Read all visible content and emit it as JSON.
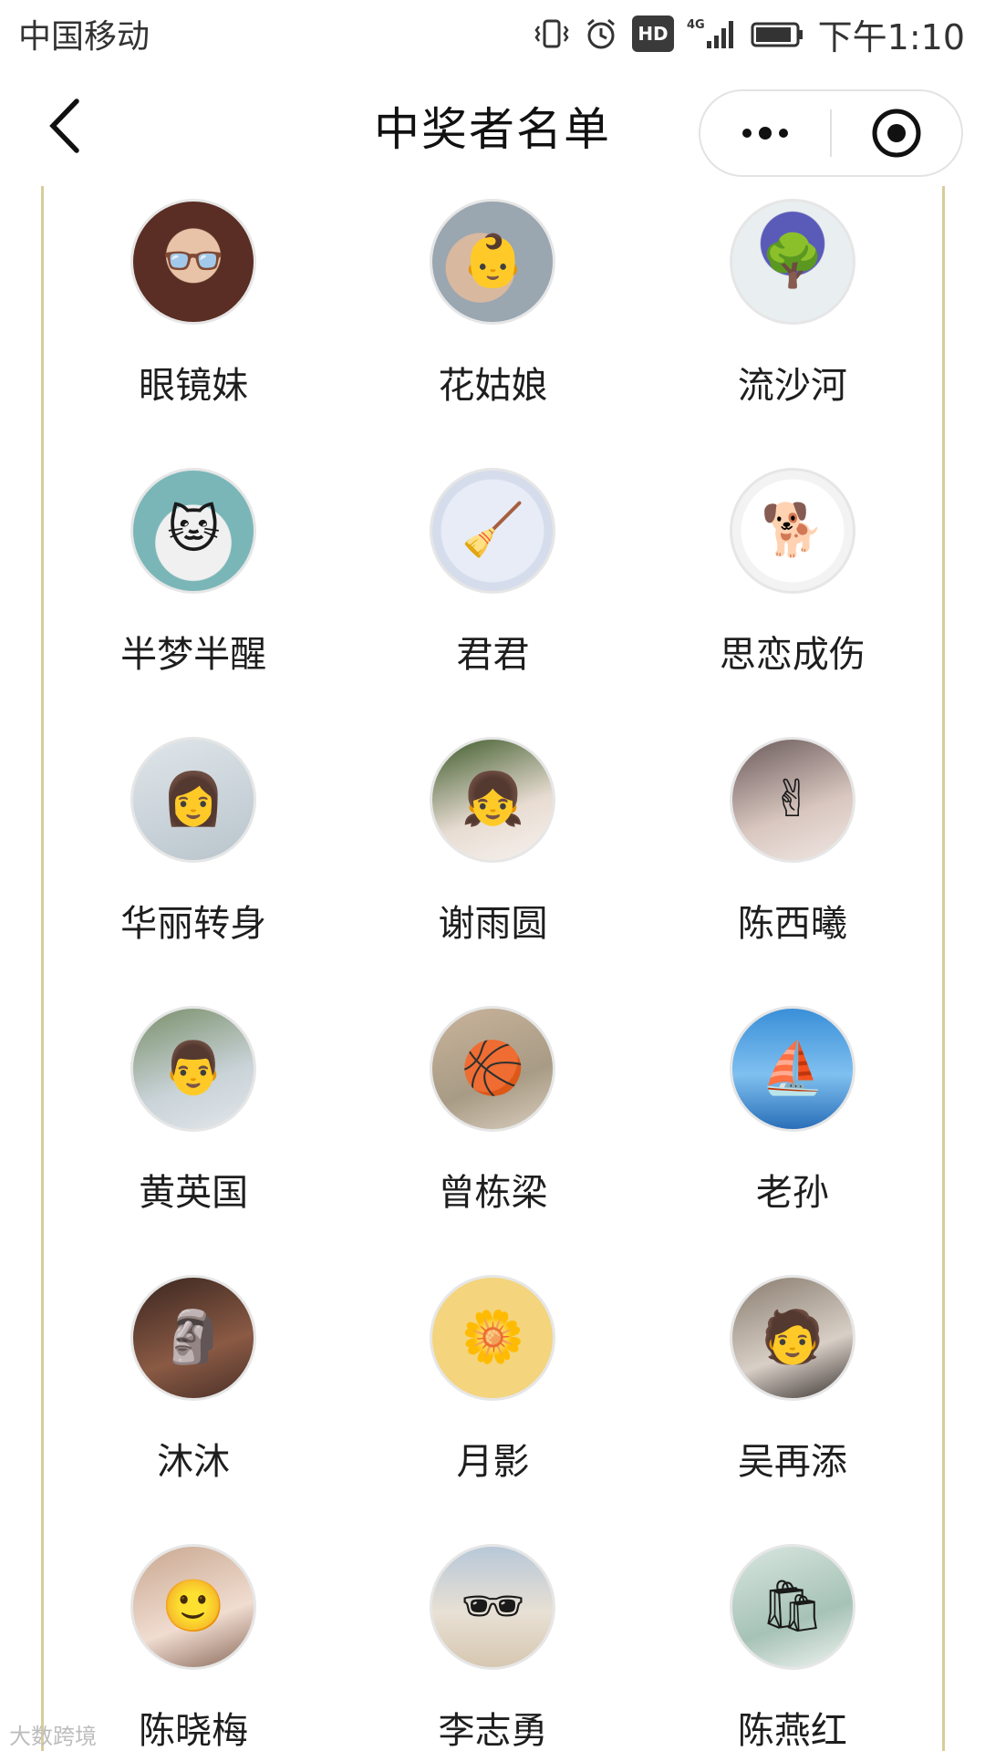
{
  "status_bar": {
    "carrier": "中国移动",
    "hd": "HD",
    "network": "4G",
    "time": "下午1:10",
    "icons": [
      "vibrate-icon",
      "alarm-icon",
      "hd-icon",
      "signal-icon",
      "battery-icon"
    ]
  },
  "title_bar": {
    "title": "中奖者名单",
    "back_icon": "chevron-left-icon",
    "more_icon": "more-dots-icon",
    "close_icon": "target-circle-icon"
  },
  "colors": {
    "frame": "#d8cc9c",
    "avatar_border": "#e6e6e6"
  },
  "winners": [
    {
      "name": "眼镜妹",
      "avatar": "girl-with-glasses-avatar"
    },
    {
      "name": "花姑娘",
      "avatar": "child-photo-avatar"
    },
    {
      "name": "流沙河",
      "avatar": "purple-tree-avatar"
    },
    {
      "name": "半梦半醒",
      "avatar": "cat-with-cap-avatar"
    },
    {
      "name": "君君",
      "avatar": "witch-on-broom-avatar"
    },
    {
      "name": "思恋成伤",
      "avatar": "cartoon-dog-avatar"
    },
    {
      "name": "华丽转身",
      "avatar": "nurse-photo-avatar"
    },
    {
      "name": "谢雨圆",
      "avatar": "girl-portrait-avatar"
    },
    {
      "name": "陈西曦",
      "avatar": "girl-selfie-avatar"
    },
    {
      "name": "黄英国",
      "avatar": "man-white-shirt-avatar"
    },
    {
      "name": "曾栋梁",
      "avatar": "boy-with-basketball-avatar"
    },
    {
      "name": "老孙",
      "avatar": "sailboat-avatar"
    },
    {
      "name": "沐沐",
      "avatar": "figurine-avatar"
    },
    {
      "name": "月影",
      "avatar": "yellow-flower-avatar"
    },
    {
      "name": "吴再添",
      "avatar": "young-man-avatar"
    },
    {
      "name": "陈晓梅",
      "avatar": "girl-closeup-avatar"
    },
    {
      "name": "李志勇",
      "avatar": "man-sunglasses-avatar"
    },
    {
      "name": "陈燕红",
      "avatar": "woman-shopping-avatar"
    }
  ],
  "watermark": "大数跨境"
}
